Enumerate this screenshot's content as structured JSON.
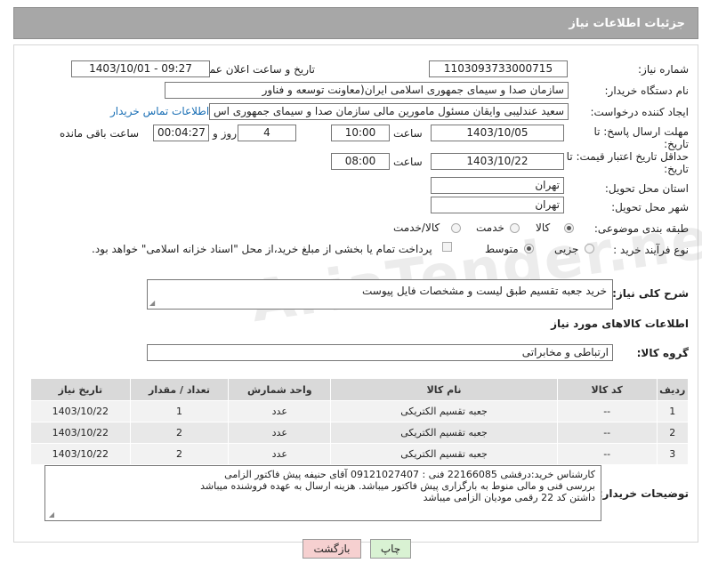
{
  "header": {
    "title": "جزئیات اطلاعات نیاز"
  },
  "fields": {
    "need_number_label": "شماره نیاز:",
    "need_number": "1103093733000715",
    "announce_label": "تاریخ و ساعت اعلان عمومی:",
    "announce_value": "1403/10/01 - 09:27",
    "buyer_org_label": "نام دستگاه خریدار:",
    "buyer_org": "سازمان صدا و سیمای جمهوری اسلامی ایران(معاونت توسعه و فناور",
    "creator_label": "ایجاد کننده درخواست:",
    "creator": "سعید عندلیبی وایقان مسئول مامورین مالی  سازمان صدا و سیمای جمهوری اس",
    "contact_link": "اطلاعات تماس خریدار",
    "deadline_label_1": "مهلت ارسال پاسخ: تا",
    "deadline_label_2": "تاریخ:",
    "deadline_date": "1403/10/05",
    "time_label": "ساعت",
    "deadline_time": "10:00",
    "days_value": "4",
    "days_label": "روز و",
    "remaining_value": "00:04:27",
    "remaining_label": "ساعت باقی مانده",
    "validity_label_1": "حداقل تاریخ اعتبار قیمت: تا",
    "validity_label_2": "تاریخ:",
    "validity_date": "1403/10/22",
    "validity_time": "08:00",
    "province_label": "استان محل تحویل:",
    "province": "تهران",
    "city_label": "شهر محل تحویل:",
    "city": "تهران",
    "category_label": "طبقه بندی موضوعی:",
    "category_options": [
      "کالا",
      "خدمت",
      "کالا/خدمت"
    ],
    "process_label": "نوع فرآیند خرید :",
    "process_options": [
      "جزیی",
      "متوسط"
    ],
    "payment_note": "پرداخت تمام یا بخشی از مبلغ خرید،از محل \"اسناد خزانه اسلامی\" خواهد بود."
  },
  "description": {
    "label": "شرح کلی نیاز:",
    "text": "خرید جعبه تقسیم طبق لیست و مشخصات فایل پیوست"
  },
  "goods_section_title": "اطلاعات کالاهای مورد نیاز",
  "goods_group": {
    "label": "گروه کالا:",
    "value": "ارتباطی و مخابراتی"
  },
  "table": {
    "headers": [
      "ردیف",
      "کد کالا",
      "نام کالا",
      "واحد شمارش",
      "تعداد / مقدار",
      "تاریخ نیاز"
    ],
    "rows": [
      [
        "1",
        "--",
        "جعبه تقسیم الکتریکی",
        "عدد",
        "1",
        "1403/10/22"
      ],
      [
        "2",
        "--",
        "جعبه تقسیم الکتریکی",
        "عدد",
        "2",
        "1403/10/22"
      ],
      [
        "3",
        "--",
        "جعبه تقسیم الکتریکی",
        "عدد",
        "2",
        "1403/10/22"
      ]
    ]
  },
  "buyer_notes": {
    "label": "توضیحات خریدار:",
    "lines": [
      "کارشناس خرید:درفشی 22166085 فنی : 09121027407 آقای حنیفه پیش فاکتور الزامی",
      "بررسی فنی و مالی منوط به بارگزاری پیش فاکتور میباشد. هزینه ارسال به عهده فروشنده میباشد",
      "داشتن کد 22 رقمی مودیان الزامی میباشد"
    ]
  },
  "buttons": {
    "print": "چاپ",
    "back": "بازگشت"
  },
  "watermark": "AriaTender.net",
  "colors": {
    "header_bg": "#a7a7a7",
    "link": "#1a6fb5",
    "print_btn": "#d9f2d3",
    "back_btn": "#f6d0d0"
  }
}
